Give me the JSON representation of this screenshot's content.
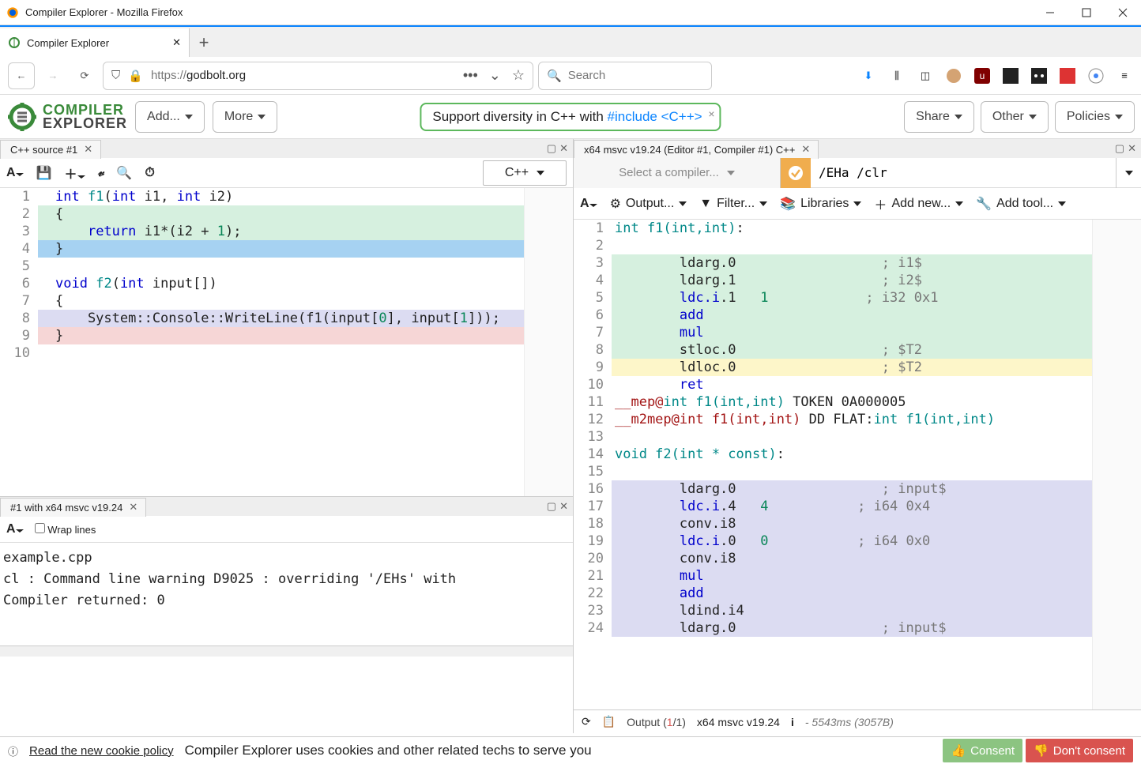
{
  "window": {
    "title": "Compiler Explorer - Mozilla Firefox"
  },
  "browser": {
    "tab_title": "Compiler Explorer",
    "url_scheme": "https://",
    "url_host": "godbolt.org",
    "search_placeholder": "Search"
  },
  "appbar": {
    "logo_line1": "COMPILER",
    "logo_line2": "EXPLORER",
    "add": "Add...",
    "more": "More",
    "share": "Share",
    "other": "Other",
    "policies": "Policies",
    "notice_pre": "Support diversity in C++ with ",
    "notice_link": "#include <C++>"
  },
  "source_panel": {
    "tab": "C++ source #1",
    "language": "C++",
    "lines": [
      {
        "n": "1",
        "hl": "",
        "html": "<span class='kw'>int</span> <span class='fn'>f1</span>(<span class='kw'>int</span> i1, <span class='kw'>int</span> i2)"
      },
      {
        "n": "2",
        "hl": "hl-green",
        "html": "{"
      },
      {
        "n": "3",
        "hl": "hl-green",
        "html": "    <span class='kw'>return</span> i1*(i2 + <span class='num'>1</span>);"
      },
      {
        "n": "4",
        "hl": "hl-blue",
        "html": "}"
      },
      {
        "n": "5",
        "hl": "",
        "html": ""
      },
      {
        "n": "6",
        "hl": "",
        "html": "<span class='kw'>void</span> <span class='fn'>f2</span>(<span class='kw'>int</span> input[])"
      },
      {
        "n": "7",
        "hl": "",
        "html": "{"
      },
      {
        "n": "8",
        "hl": "hl-purple",
        "html": "    System::Console::WriteLine(f1(input[<span class='num'>0</span>], input[<span class='num'>1</span>]));"
      },
      {
        "n": "9",
        "hl": "hl-red",
        "html": "}"
      },
      {
        "n": "10",
        "hl": "",
        "html": ""
      }
    ]
  },
  "compiler_panel": {
    "tab": "x64 msvc v19.24 (Editor #1, Compiler #1) C++",
    "select_label": "Select a compiler...",
    "args": "/EHa /clr",
    "toolbar2": {
      "output": "Output...",
      "filter": "Filter...",
      "libs": "Libraries",
      "addnew": "Add new...",
      "addtool": "Add tool..."
    },
    "lines": [
      {
        "n": "1",
        "hl": "",
        "html": "<span class='fn'>int f1(int,int)</span>:"
      },
      {
        "n": "2",
        "hl": "",
        "html": ""
      },
      {
        "n": "3",
        "hl": "hl-green",
        "html": "        ldarg.0                  <span class='cmt'>; i1$</span>"
      },
      {
        "n": "4",
        "hl": "hl-green",
        "html": "        ldarg.1                  <span class='cmt'>; i2$</span>"
      },
      {
        "n": "5",
        "hl": "hl-green",
        "html": "        <span class='kw'>ldc.i</span>.1   <span class='num'>1</span>            <span class='cmt'>; i32 0x1</span>"
      },
      {
        "n": "6",
        "hl": "hl-green",
        "html": "        <span class='kw'>add</span>"
      },
      {
        "n": "7",
        "hl": "hl-green",
        "html": "        <span class='kw'>mul</span>"
      },
      {
        "n": "8",
        "hl": "hl-green",
        "html": "        stloc.0                  <span class='cmt'>; $T2</span>"
      },
      {
        "n": "9",
        "hl": "hl-yellow",
        "html": "        ldloc.0                  <span class='cmt'>; $T2</span>"
      },
      {
        "n": "10",
        "hl": "",
        "html": "        <span class='kw'>ret</span>"
      },
      {
        "n": "11",
        "hl": "",
        "html": "<span class='dir'>__mep@</span><span class='fn'>int f1(int,int)</span> TOKEN 0A000005"
      },
      {
        "n": "12",
        "hl": "",
        "html": "<span class='dir'>__m2mep@int f1(int,int)</span> DD FLAT:<span class='fn'>int f1(int,int)</span>"
      },
      {
        "n": "13",
        "hl": "",
        "html": ""
      },
      {
        "n": "14",
        "hl": "",
        "html": "<span class='fn'>void f2(int * const)</span>:"
      },
      {
        "n": "15",
        "hl": "",
        "html": ""
      },
      {
        "n": "16",
        "hl": "hl-purple",
        "html": "        ldarg.0                  <span class='cmt'>; input$</span>"
      },
      {
        "n": "17",
        "hl": "hl-purple",
        "html": "        <span class='kw'>ldc.i</span>.4   <span class='num'>4</span>           <span class='cmt'>; i64 0x4</span>"
      },
      {
        "n": "18",
        "hl": "hl-purple",
        "html": "        conv.i8"
      },
      {
        "n": "19",
        "hl": "hl-purple",
        "html": "        <span class='kw'>ldc.i</span>.0   <span class='num'>0</span>           <span class='cmt'>; i64 0x0</span>"
      },
      {
        "n": "20",
        "hl": "hl-purple",
        "html": "        conv.i8"
      },
      {
        "n": "21",
        "hl": "hl-purple",
        "html": "        <span class='kw'>mul</span>"
      },
      {
        "n": "22",
        "hl": "hl-purple",
        "html": "        <span class='kw'>add</span>"
      },
      {
        "n": "23",
        "hl": "hl-purple",
        "html": "        ldind.i4"
      },
      {
        "n": "24",
        "hl": "hl-purple",
        "html": "        ldarg.0                  <span class='cmt'>; input$</span>"
      }
    ],
    "status": {
      "output_label": "Output (",
      "out1": "1",
      "out2": "/1)",
      "compiler": "x64 msvc v19.24",
      "time": "- 5543ms (3057B)"
    }
  },
  "output_panel": {
    "tab": "#1 with x64 msvc v19.24",
    "wrap": "Wrap lines",
    "lines": [
      "example.cpp",
      "cl : Command line warning D9025 : overriding '/EHs' with",
      "Compiler returned: 0"
    ]
  },
  "cookie": {
    "link": "Read the new cookie policy",
    "msg": "Compiler Explorer uses cookies and other related techs to serve you",
    "consent": "Consent",
    "dont": "Don't consent"
  }
}
